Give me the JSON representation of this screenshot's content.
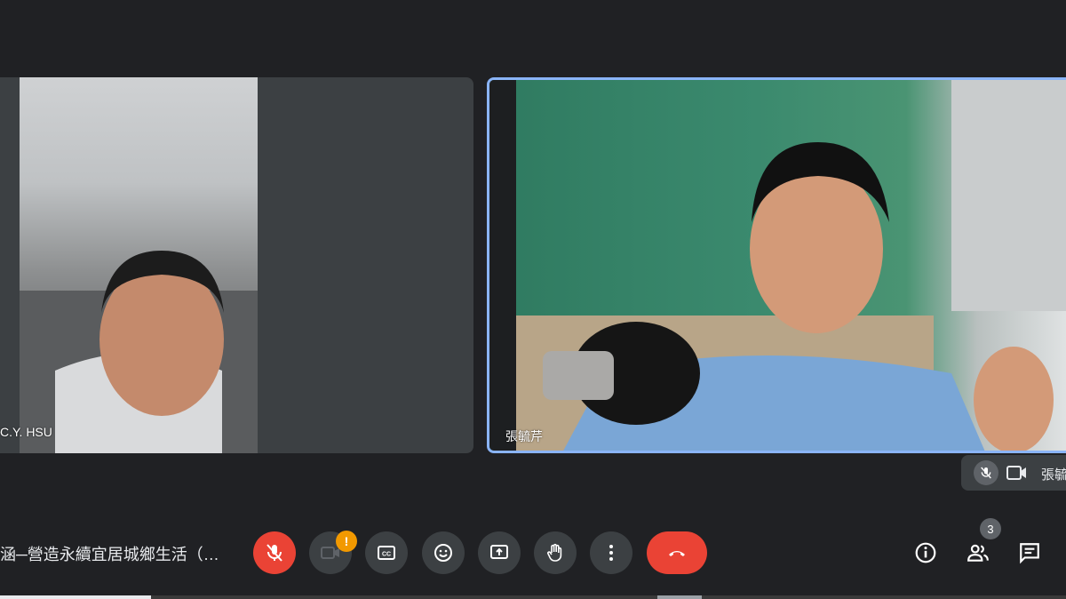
{
  "participants": [
    {
      "name": "C.Y. HSU"
    },
    {
      "name": "張毓芹"
    }
  ],
  "mini_bar": {
    "name": "張毓"
  },
  "meeting": {
    "title": "涵─營造永續宜居城鄉生活（…"
  },
  "controls": {
    "camera_warning": "!",
    "people_count": "3"
  },
  "colors": {
    "accent": "#8ab4f8",
    "danger": "#ea4335",
    "warning": "#f29900",
    "background": "#202124",
    "tile": "#3c4043"
  },
  "icons": [
    "mic-off-icon",
    "camera-off-icon",
    "captions-icon",
    "emoji-icon",
    "present-screen-icon",
    "raise-hand-icon",
    "more-vert-icon",
    "call-end-icon",
    "info-icon",
    "people-icon",
    "chat-icon"
  ]
}
